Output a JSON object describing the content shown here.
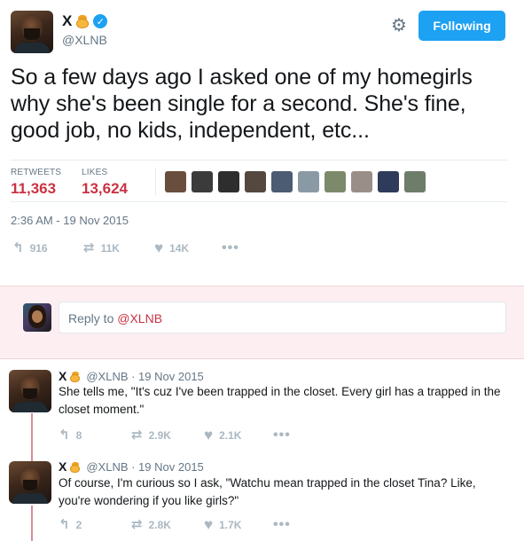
{
  "main_tweet": {
    "name": "X",
    "handle": "@XLNB",
    "follow_label": "Following",
    "text": "So a few days ago I asked one of my homegirls why she's been single for a second. She's fine, good job, no kids, independent, etc...",
    "retweets_label": "RETWEETS",
    "retweets_count": "11,363",
    "likes_label": "LIKES",
    "likes_count": "13,624",
    "timestamp": "2:36 AM - 19 Nov 2015",
    "actions": {
      "reply_count": "916",
      "retweet_count": "11K",
      "like_count": "14K"
    }
  },
  "reply_box": {
    "placeholder_prefix": "Reply to ",
    "mention": "@XLNB"
  },
  "replies": [
    {
      "name": "X",
      "meta": "@XLNB · 19 Nov 2015",
      "text": "She tells me, \"It's cuz I've been trapped in the closet. Every girl has a trapped in the closet moment.\"",
      "reply_count": "8",
      "retweet_count": "2.9K",
      "like_count": "2.1K"
    },
    {
      "name": "X",
      "meta": "@XLNB · 19 Nov 2015",
      "text": "Of course, I'm curious so I ask, \"Watchu mean trapped in the closet Tina? Like, you're wondering if you like girls?\"",
      "reply_count": "2",
      "retweet_count": "2.8K",
      "like_count": "1.7K"
    }
  ],
  "colors": {
    "accent_blue": "#1da1f2",
    "count_red": "#c93344",
    "muted": "#657786",
    "icon_gray": "#aab8c2",
    "reply_bg": "#fdeff1"
  },
  "liker_colors": [
    "#6a4e3d",
    "#3b3b3b",
    "#2e2e2e",
    "#55483f",
    "#4b5c73",
    "#8a9aa5",
    "#7c8a6b",
    "#9a8f88",
    "#2f3b5a",
    "#6e7d6a"
  ]
}
